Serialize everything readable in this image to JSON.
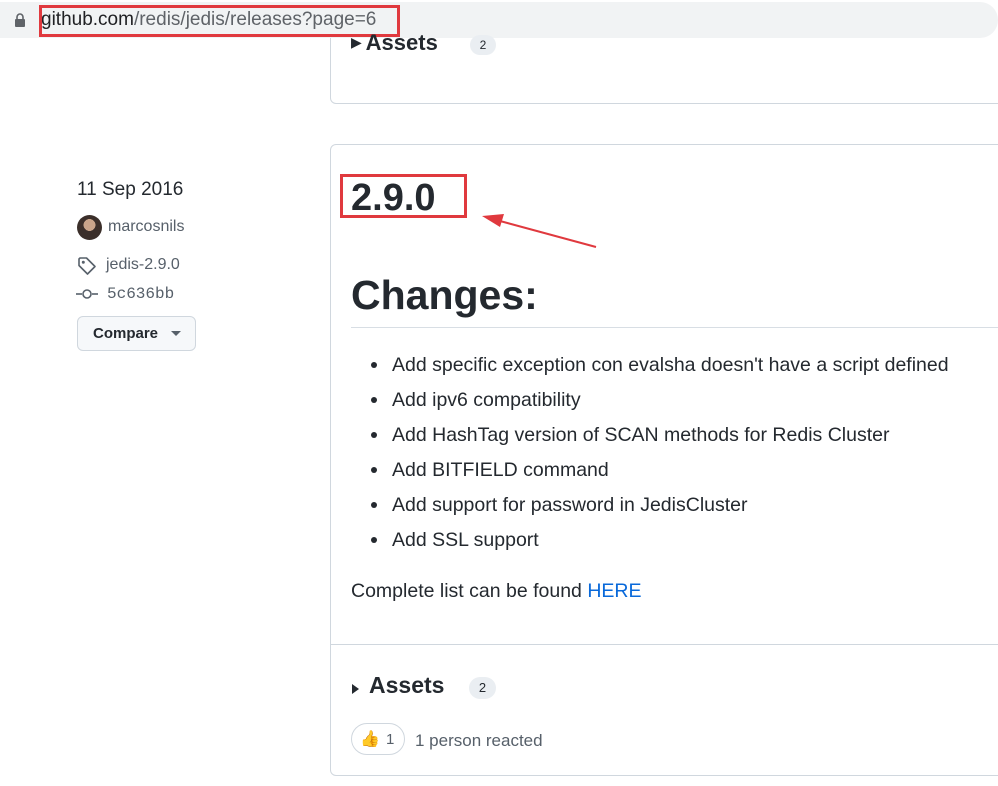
{
  "browser": {
    "url_domain": "github.com",
    "url_path": "/redis/jedis/releases?page=6"
  },
  "previous_release": {
    "assets_label": "Assets",
    "assets_count": "2"
  },
  "release": {
    "date": "11 Sep 2016",
    "author": "marcosnils",
    "tag": "jedis-2.9.0",
    "commit": "5c636bb",
    "compare_label": "Compare",
    "version": "2.9.0",
    "heading": "Changes:",
    "changes": [
      "Add specific exception con evalsha doesn't have a script defined",
      "Add ipv6 compatibility",
      "Add HashTag version of SCAN methods for Redis Cluster",
      "Add BITFIELD command",
      "Add support for password in JedisCluster",
      "Add SSL support"
    ],
    "complete_text": "Complete list can be found ",
    "complete_link": "HERE",
    "assets_label": "Assets",
    "assets_count": "2",
    "reaction_emoji": "👍",
    "reaction_count": "1",
    "reacted_text": "1 person reacted"
  },
  "colors": {
    "annotation_red": "#e0393e",
    "link_blue": "#0969da",
    "border": "#d0d7de"
  },
  "icons": [
    "lock-icon",
    "tag-icon",
    "commit-icon",
    "caret-down-icon",
    "arrow-annotation",
    "thumbs-up-icon"
  ]
}
